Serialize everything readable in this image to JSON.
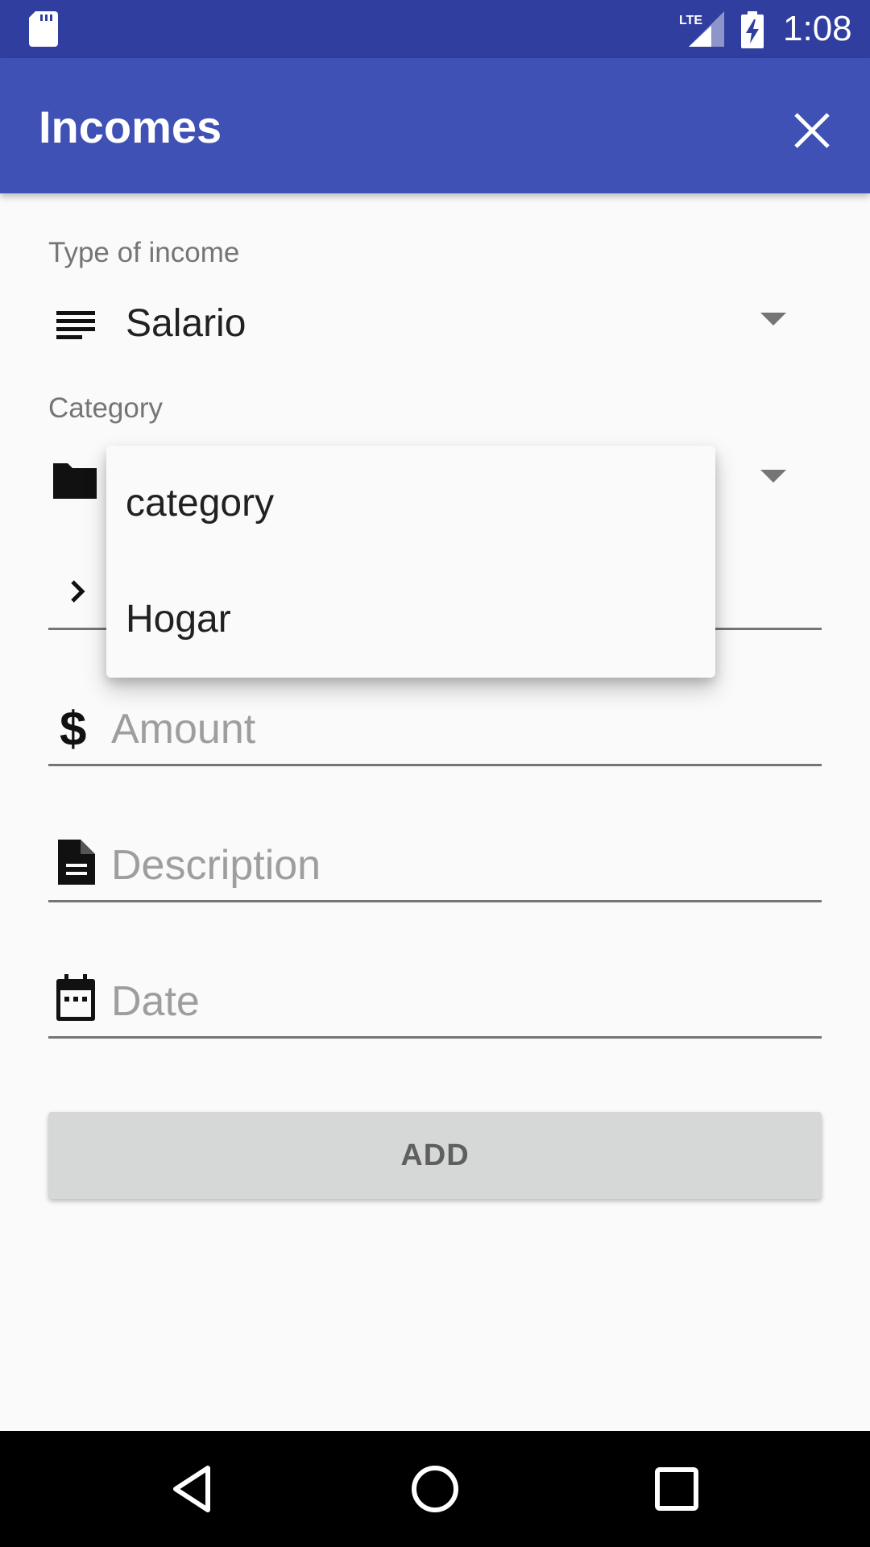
{
  "status_bar": {
    "network": "LTE",
    "time": "1:08",
    "icons": [
      "sd-card-icon",
      "lte-signal-icon",
      "battery-charging-icon"
    ]
  },
  "app_bar": {
    "title": "Incomes",
    "close_icon": "close-icon"
  },
  "form": {
    "type_label": "Type of income",
    "type_value": "Salario",
    "type_icon": "subject-lines-icon",
    "category_label": "Category",
    "category_icon": "folder-icon",
    "subcategory_icon": "chevron-right-icon",
    "amount_placeholder": "Amount",
    "amount_icon": "dollar-icon",
    "description_placeholder": "Description",
    "description_icon": "document-icon",
    "date_placeholder": "Date",
    "date_icon": "calendar-icon",
    "add_label": "ADD"
  },
  "dropdown": {
    "options": [
      "category",
      "Hogar"
    ]
  },
  "nav_bar": {
    "icons": [
      "back-icon",
      "home-icon",
      "recents-icon"
    ]
  },
  "colors": {
    "status_bar": "#303F9F",
    "app_bar": "#3F51B5",
    "background": "#FAFAFA",
    "button": "#D6D7D7"
  }
}
